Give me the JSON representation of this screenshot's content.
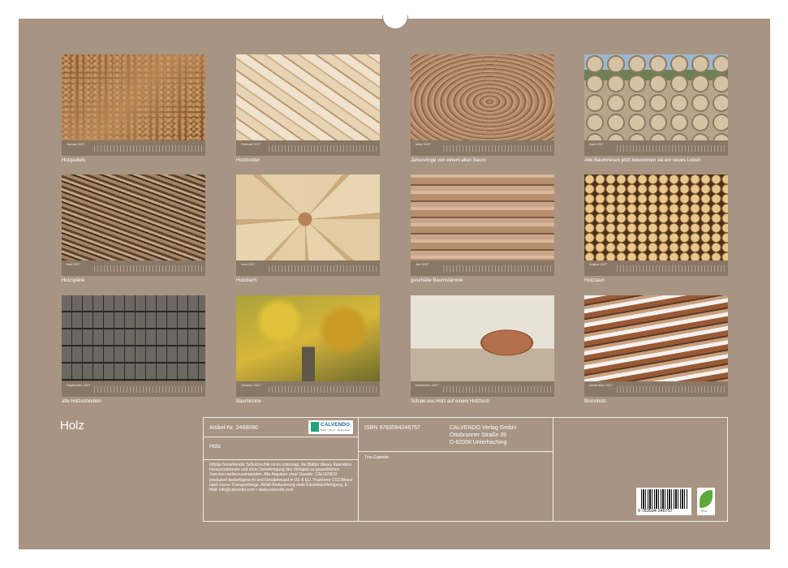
{
  "calendar": {
    "title": "Holz",
    "months": [
      {
        "name": "Januar 2027",
        "caption": "Holzpellets"
      },
      {
        "name": "Februar 2027",
        "caption": "Holzbretter"
      },
      {
        "name": "März 2027",
        "caption": "Jahresringe von einem alten Baum"
      },
      {
        "name": "April 2027",
        "caption": "Alte Baumriesen jetzt bekommen sie ein neues Leben"
      },
      {
        "name": "Mai 2027",
        "caption": "Holzspäne"
      },
      {
        "name": "Juni 2027",
        "caption": "Holzdach"
      },
      {
        "name": "Juli 2027",
        "caption": "geschälte Baumstämme"
      },
      {
        "name": "August 2027",
        "caption": "Holzzaun"
      },
      {
        "name": "September 2027",
        "caption": "alte Holzschindeln"
      },
      {
        "name": "Oktober 2027",
        "caption": "Baumkrone"
      },
      {
        "name": "November 2027",
        "caption": "Schale aus Holz auf einem Holztisch"
      },
      {
        "name": "Dezember 2027",
        "caption": "Brennholz"
      }
    ]
  },
  "info": {
    "article_no": "Artikel-Nr. 2468090",
    "logo_name": "CALVENDO",
    "logo_sub": "Natur · Kunst · Technologie",
    "product_title": "Holz",
    "isbn": "ISBN 9783594246757",
    "publisher_line1": "CALVENDO Verlag GmbH",
    "publisher_line2": "Ottobrunner Straße 39",
    "publisher_line3": "D-82008 Unterhaching",
    "author": "Tina Gabriele",
    "legal_text": "Infolge bestehender Schutzrechte ist es untersagt, die Blätter dieses Kalenders herauszutrennen und ohne Genehmigung des Verlages zu gewerblichen Zwecken weiterzuverwenden. Alle Angaben ohne Gewähr. CALVENDO produziert bedarfsgerecht und klimabewusst in DE & EU. Positivere CO2-Bilanz dank kurzer Transportwege, Abfall-Reduzierung dank Einzelstückfertigung. E-Mail: info@calvendo.com • www.calvendo.com",
    "barcode_number": "9 783594 246757",
    "eco_label": "eco"
  }
}
